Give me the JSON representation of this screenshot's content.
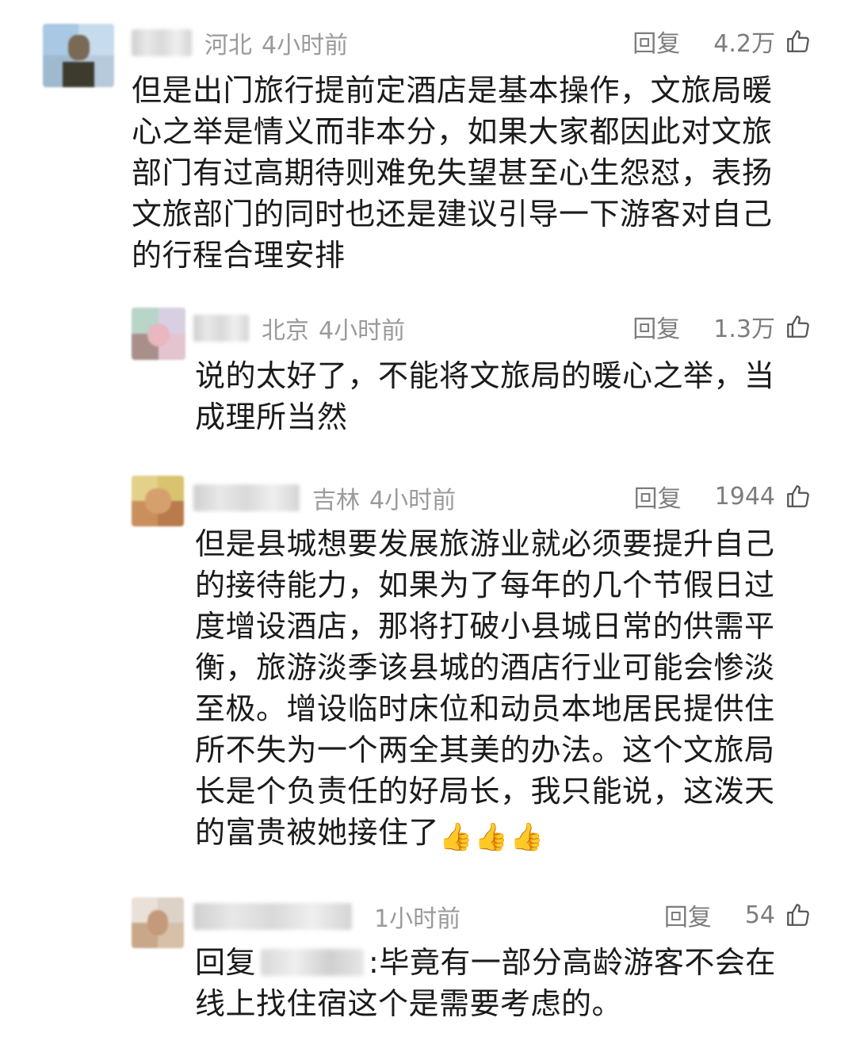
{
  "comments": [
    {
      "region": "河北",
      "time": "4小时前",
      "reply_label": "回复",
      "likes": "4.2万",
      "text": "但是出门旅行提前定酒店是基本操作，文旅局暖心之举是情义而非本分，如果大家都因此对文旅部门有过高期待则难免失望甚至心生怨怼，表扬文旅部门的同时也还是建议引导一下游客对自己的行程合理安排"
    },
    {
      "region": "北京",
      "time": "4小时前",
      "reply_label": "回复",
      "likes": "1.3万",
      "text": "说的太好了，不能将文旅局的暖心之举，当成理所当然"
    },
    {
      "region": "吉林",
      "time": "4小时前",
      "reply_label": "回复",
      "likes": "1944",
      "text": "但是县城想要发展旅游业就必须要提升自己的接待能力，如果为了每年的几个节假日过度增设酒店，那将打破小县城日常的供需平衡，旅游淡季该县城的酒店行业可能会惨淡至极。增设临时床位和动员本地居民提供住所不失为一个两全其美的办法。这个文旅局长是个负责任的好局长，我只能说，这泼天的富贵被她接住了",
      "emoji": [
        "👍",
        "👍",
        "👍"
      ]
    },
    {
      "region": "",
      "time": "1小时前",
      "reply_label": "回复",
      "likes": "54",
      "reply_prefix": "回复",
      "text": ":毕竟有一部分高龄游客不会在线上找住宿这个是需要考虑的。"
    }
  ],
  "icons": {
    "like": "thumbs-up-outline-icon"
  },
  "colors": {
    "meta": "#9a9a9a",
    "text": "#1b1b1b"
  }
}
